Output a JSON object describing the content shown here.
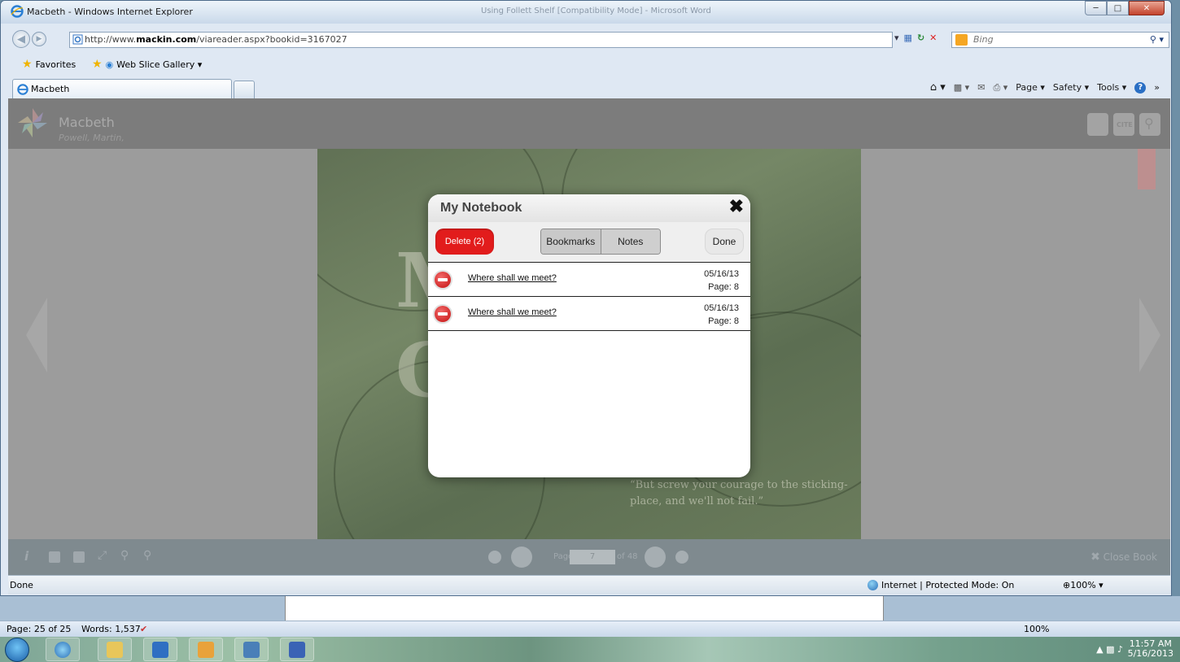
{
  "window": {
    "title": "Macbeth - Windows Internet Explorer",
    "background_title": "Using Follett Shelf [Compatibility Mode] - Microsoft Word"
  },
  "address_bar": {
    "url_prefix": "http://www.",
    "url_domain": "mackin.com",
    "url_path": "/viareader.aspx?bookid=3167027",
    "search_placeholder": "Bing"
  },
  "favorites_bar": {
    "favorites_label": "Favorites",
    "web_slice_label": "Web Slice Gallery ▾"
  },
  "tab": {
    "label": "Macbeth"
  },
  "command_bar": {
    "page": "Page ▾",
    "safety": "Safety ▾",
    "tools": "Tools ▾"
  },
  "reader": {
    "book_title": "Macbeth",
    "book_author": "Powell, Martin,",
    "cover_letter_1": "M",
    "cover_letter_2": "C",
    "cover_quote": "“But screw your courage to the sticking-place, and we'll not fail.”",
    "page_label": "Page",
    "page_value": "7",
    "page_total": "of 48",
    "close_book": "Close Book"
  },
  "notebook": {
    "title": "My Notebook",
    "delete_label": "Delete (2)",
    "tabs": [
      "Bookmarks",
      "Notes"
    ],
    "done_label": "Done",
    "entries": [
      {
        "text": "Where shall we meet?",
        "date": "05/16/13",
        "page": "Page: 8"
      },
      {
        "text": "Where shall we meet?",
        "date": "05/16/13",
        "page": "Page: 8"
      }
    ]
  },
  "status_bar": {
    "status": "Done",
    "zone": "Internet | Protected Mode: On",
    "zoom": "⊕100% ▾"
  },
  "word_status": {
    "page": "Page: 25 of 25",
    "words": "Words: 1,537",
    "zoom": "100%"
  },
  "taskbar": {
    "time": "11:57 AM",
    "date": "5/16/2013"
  },
  "colors": {
    "delete_red": "#e21c1c",
    "reader_header": "#7c7c7c",
    "reader_footer": "#7f8a8f"
  }
}
